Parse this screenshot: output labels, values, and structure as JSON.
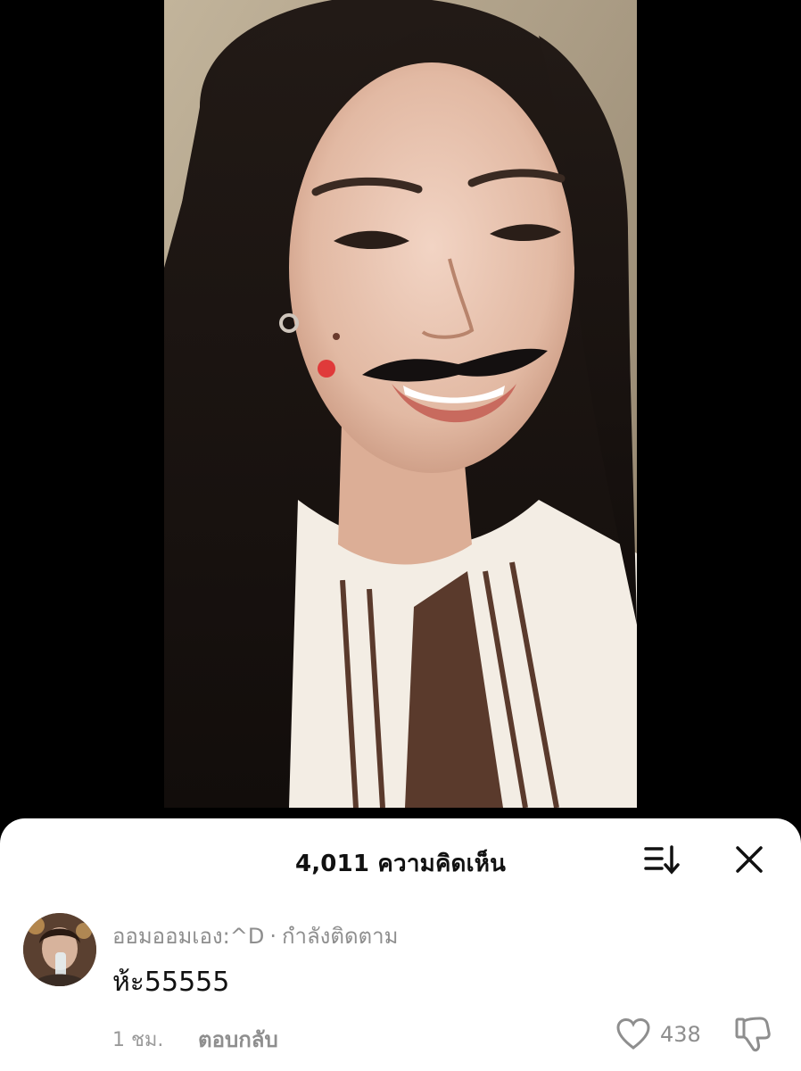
{
  "comments_sheet": {
    "title": "4,011 ความคิดเห็น",
    "sort_icon": "sort-descending-icon",
    "close_icon": "close-icon"
  },
  "comment": {
    "username": "ออมออมเอง:^D",
    "separator": "·",
    "follow_status": "กำลังติดตาม",
    "text": "ห้ะ55555",
    "time": "1 ชม.",
    "reply_label": "ตอบกลับ",
    "like_count": "438",
    "like_icon": "heart-outline-icon",
    "dislike_icon": "thumbs-down-icon"
  },
  "colors": {
    "sheet_background": "#ffffff",
    "secondary_text": "#8e8e8e",
    "primary_text": "#111111"
  }
}
